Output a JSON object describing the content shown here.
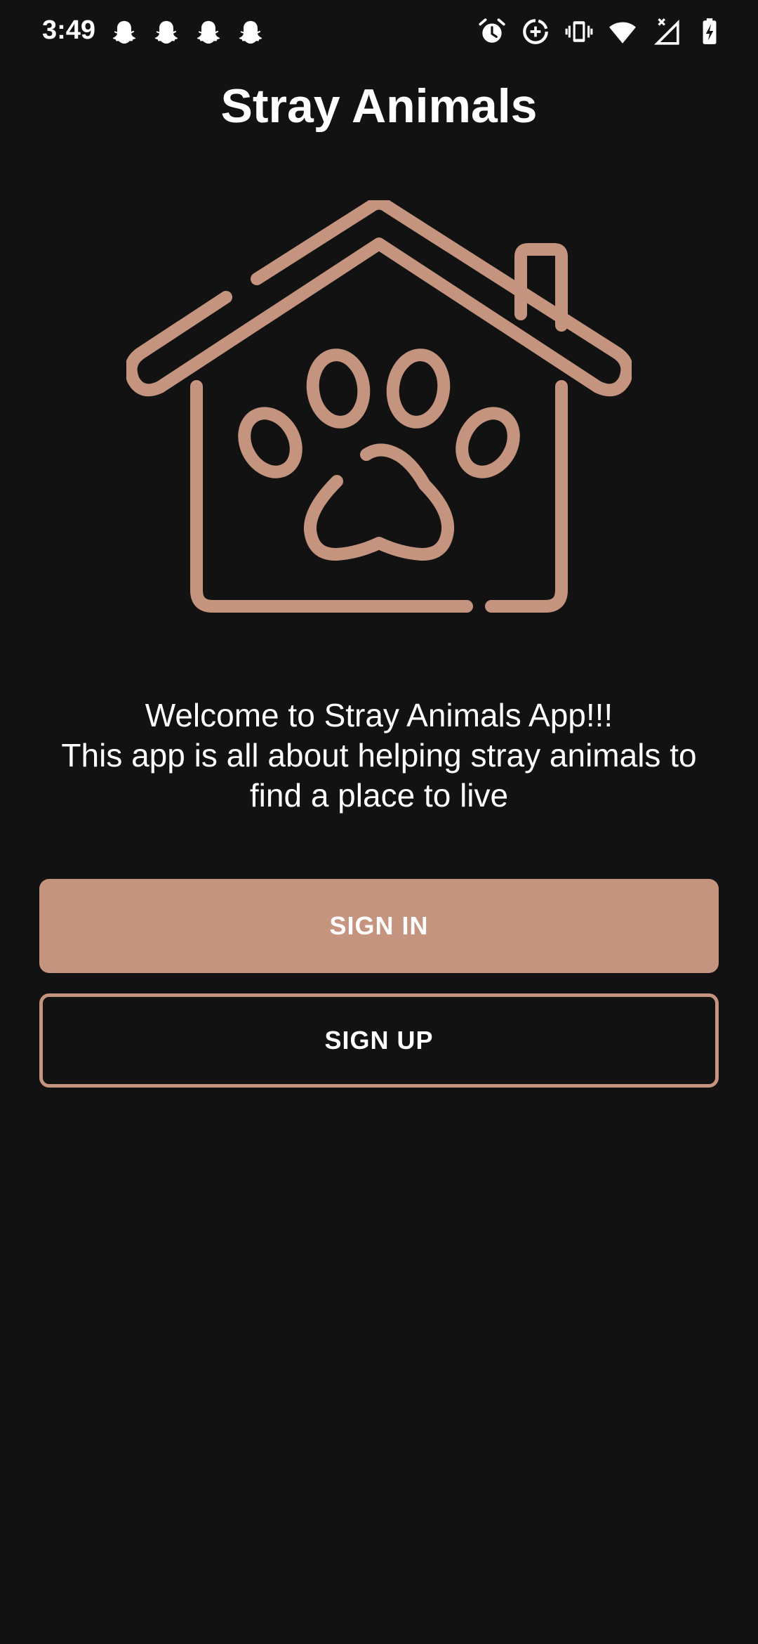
{
  "status_bar": {
    "time": "3:49",
    "notification_icons": [
      "snapchat-icon",
      "snapchat-icon",
      "snapchat-icon",
      "snapchat-icon"
    ],
    "system_icons": [
      "alarm-icon",
      "data-saver-icon",
      "vibrate-icon",
      "wifi-icon",
      "signal-no-service-icon",
      "battery-charging-icon"
    ]
  },
  "app": {
    "title": "Stray Animals"
  },
  "hero": {
    "icon": "house-paw-icon"
  },
  "welcome": {
    "line1": "Welcome to Stray Animals App!!!",
    "line2": "This app is all about helping stray animals to",
    "line3": "find a place to live"
  },
  "buttons": {
    "sign_in": "SIGN IN",
    "sign_up": "SIGN UP"
  },
  "colors": {
    "background": "#121212",
    "accent": "#c5947f",
    "text": "#ffffff"
  }
}
